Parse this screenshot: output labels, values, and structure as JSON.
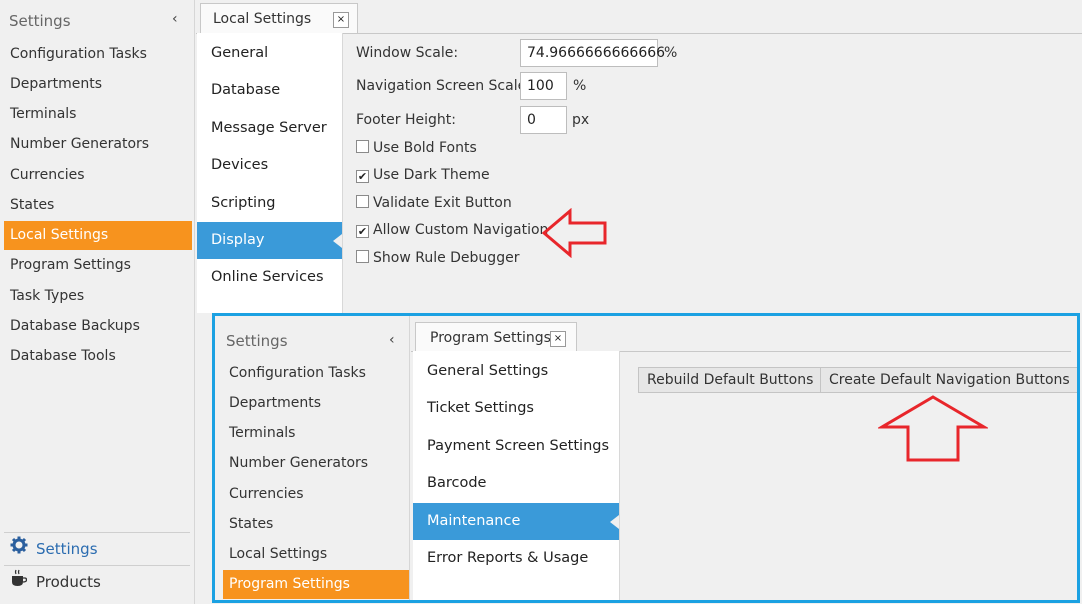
{
  "sidebar": {
    "header": "Settings",
    "collapse_glyph": "‹",
    "items": [
      {
        "label": "Configuration Tasks"
      },
      {
        "label": "Departments"
      },
      {
        "label": "Terminals"
      },
      {
        "label": "Number Generators"
      },
      {
        "label": "Currencies"
      },
      {
        "label": "States"
      },
      {
        "label": "Local Settings"
      },
      {
        "label": "Program Settings"
      },
      {
        "label": "Task Types"
      },
      {
        "label": "Database Backups"
      },
      {
        "label": "Database Tools"
      }
    ],
    "active_index": 6,
    "bottom": [
      {
        "label": "Settings",
        "icon": "gear-icon"
      },
      {
        "label": "Products",
        "icon": "coffee-cup-icon"
      }
    ]
  },
  "tab": {
    "label": "Local Settings",
    "close": "×"
  },
  "categories": {
    "items": [
      "General",
      "Database",
      "Message Server",
      "Devices",
      "Scripting",
      "Display",
      "Online Services"
    ],
    "active_index": 5
  },
  "display_form": {
    "window_scale": {
      "label": "Window Scale:",
      "value": "74.9666666666666",
      "unit": "%"
    },
    "nav_scale": {
      "label": "Navigation Screen Scale:",
      "value": "100",
      "unit": "%"
    },
    "footer_height": {
      "label": "Footer Height:",
      "value": "0",
      "unit": "px"
    },
    "checkboxes": [
      {
        "label": "Use Bold Fonts",
        "checked": false
      },
      {
        "label": "Use Dark Theme",
        "checked": true
      },
      {
        "label": "Validate Exit Button",
        "checked": false
      },
      {
        "label": "Allow Custom Navigation",
        "checked": true
      },
      {
        "label": "Show Rule Debugger",
        "checked": false
      }
    ]
  },
  "inset": {
    "sidebar": {
      "header": "Settings",
      "collapse_glyph": "‹",
      "items": [
        {
          "label": "Configuration Tasks"
        },
        {
          "label": "Departments"
        },
        {
          "label": "Terminals"
        },
        {
          "label": "Number Generators"
        },
        {
          "label": "Currencies"
        },
        {
          "label": "States"
        },
        {
          "label": "Local Settings"
        },
        {
          "label": "Program Settings"
        }
      ],
      "active_index": 7
    },
    "tab": {
      "label": "Program Settings",
      "close": "×"
    },
    "categories": {
      "items": [
        "General Settings",
        "Ticket Settings",
        "Payment Screen Settings",
        "Barcode",
        "Maintenance",
        "Error Reports & Usage"
      ],
      "active_index": 4
    },
    "buttons": {
      "rebuild": "Rebuild Default Buttons",
      "create_nav": "Create Default Navigation Buttons"
    }
  },
  "colors": {
    "accent_orange": "#f7931e",
    "accent_blue": "#3a9ad9",
    "inset_border": "#1ba1e2",
    "arrow_red": "#e8262b"
  },
  "check_glyph": "✔"
}
